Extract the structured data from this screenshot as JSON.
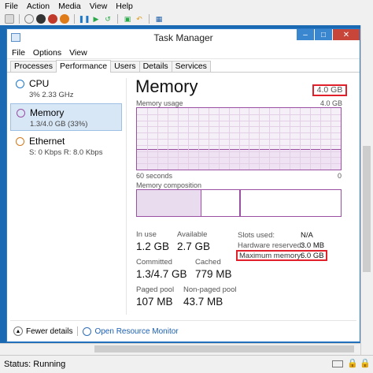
{
  "vm": {
    "menu": [
      "File",
      "Action",
      "Media",
      "View",
      "Help"
    ],
    "status": "Status: Running"
  },
  "window": {
    "title": "Task Manager",
    "menu": [
      "File",
      "Options",
      "View"
    ],
    "tabs": [
      "Processes",
      "Performance",
      "Users",
      "Details",
      "Services"
    ],
    "active_tab": "Performance"
  },
  "resources": [
    {
      "name": "CPU",
      "sub": "3% 2.33 GHz",
      "color": "#1e78c8"
    },
    {
      "name": "Memory",
      "sub": "1.3/4.0 GB (33%)",
      "color": "#9b4fa3"
    },
    {
      "name": "Ethernet",
      "sub": "S: 0 Kbps R: 8.0 Kbps",
      "color": "#d07a1e"
    }
  ],
  "detail": {
    "title": "Memory",
    "total": "4.0 GB",
    "usage_label": "Memory usage",
    "usage_max": "4.0 GB",
    "time_left": "60 seconds",
    "time_right": "0",
    "composition_label": "Memory composition",
    "usage_fraction": 0.33,
    "stats": {
      "in_use_label": "In use",
      "in_use": "1.2 GB",
      "available_label": "Available",
      "available": "2.7 GB",
      "committed_label": "Committed",
      "committed": "1.3/4.7 GB",
      "cached_label": "Cached",
      "cached": "779 MB",
      "paged_label": "Paged pool",
      "paged": "107 MB",
      "nonpaged_label": "Non-paged pool",
      "nonpaged": "43.7 MB"
    },
    "kv": {
      "slots_label": "Slots used:",
      "slots": "N/A",
      "hw_label": "Hardware reserved:",
      "hw": "3.0 MB",
      "max_label": "Maximum memory:",
      "max": "6.0 GB"
    }
  },
  "footer": {
    "fewer": "Fewer details",
    "monitor": "Open Resource Monitor"
  },
  "colors": {
    "accent": "#1a6ab3",
    "memory": "#9b4fa3",
    "highlight": "#e0202a"
  }
}
